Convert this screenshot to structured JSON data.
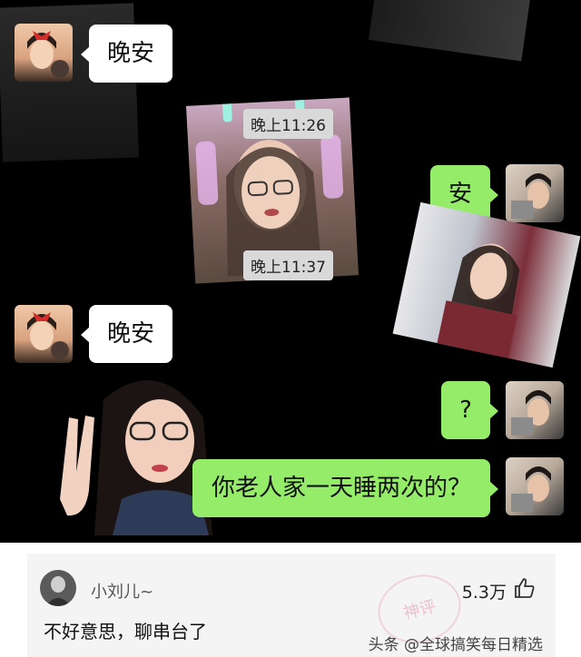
{
  "chat": {
    "messages": [
      {
        "side": "left",
        "text": "晚安"
      },
      {
        "time": "晚上11:26"
      },
      {
        "time": "晚上11:37"
      },
      {
        "side": "right",
        "text": "安"
      },
      {
        "side": "left",
        "text": "晚安"
      },
      {
        "side": "right",
        "text": "?"
      },
      {
        "side": "right",
        "text": "你老人家一天睡两次的？"
      }
    ]
  },
  "comment": {
    "username": "小刘儿~",
    "likes": "5.3万",
    "text": "不好意思，聊串台了",
    "stamp_text": "神评"
  },
  "watermark": "头条 @全球搞笑每日精选",
  "colors": {
    "chat_background": "#000000",
    "left_bubble": "#ffffff",
    "right_bubble": "#95ec69",
    "comment_background": "#f4f4f4"
  },
  "icons": [
    "thumbs-up-icon",
    "user-avatar"
  ]
}
